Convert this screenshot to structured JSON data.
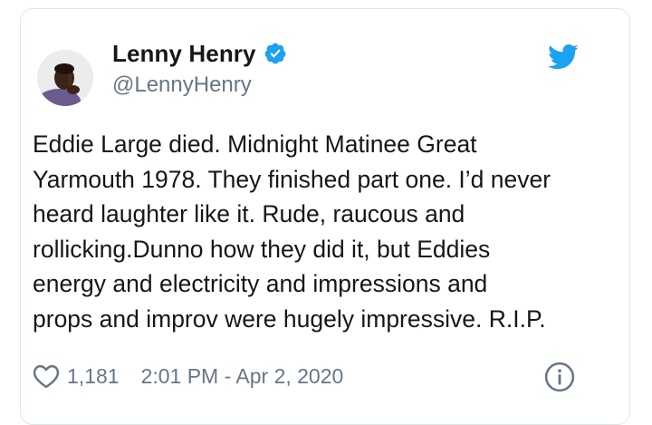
{
  "tweet": {
    "author": {
      "display_name": "Lenny Henry",
      "handle": "@LennyHenry",
      "verified": true,
      "avatar_icon": "avatar-photo"
    },
    "text": "Eddie Large died. Midnight Matinee Great\nYarmouth 1978. They finished part one. I’d never\nheard laughter like it. Rude, raucous and\nrollicking.Dunno how they did it, but Eddies\nenergy and electricity and impressions and\nprops and improv were hugely impressive. R.I.P.",
    "likes": "1,181",
    "timestamp": "2:01 PM - Apr 2, 2020"
  },
  "icons": {
    "verified": "verified-badge-icon",
    "brand": "twitter-bird-icon",
    "like": "heart-icon",
    "info": "info-icon"
  },
  "colors": {
    "brand_blue": "#1da1f2",
    "text": "#14171a",
    "secondary": "#657786"
  }
}
